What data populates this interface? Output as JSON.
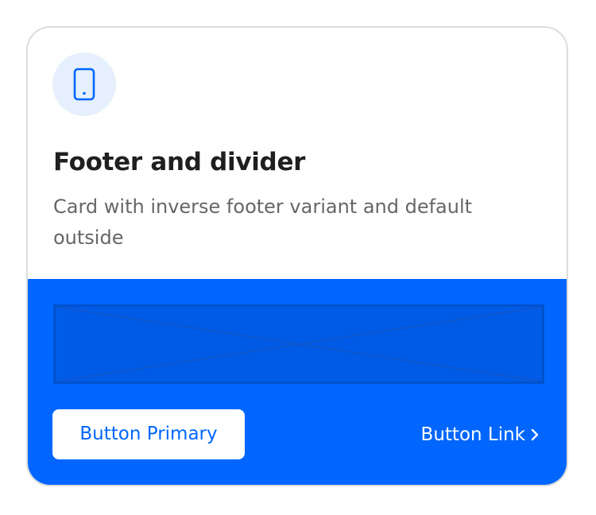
{
  "card": {
    "icon": "mobile-phone-icon",
    "title": "Footer and divider",
    "description": "Card with inverse footer variant and default outside",
    "footer": {
      "variant": "inverse",
      "primary_button_label": "Button Primary",
      "link_button_label": "Button Link",
      "link_icon": "chevron-right-icon"
    }
  },
  "colors": {
    "footer_background": "#0066ff",
    "icon_circle_background": "#e6f0fc",
    "title_text": "#1f1f1f",
    "description_text": "#666666",
    "primary_button_text": "#0066ff"
  }
}
